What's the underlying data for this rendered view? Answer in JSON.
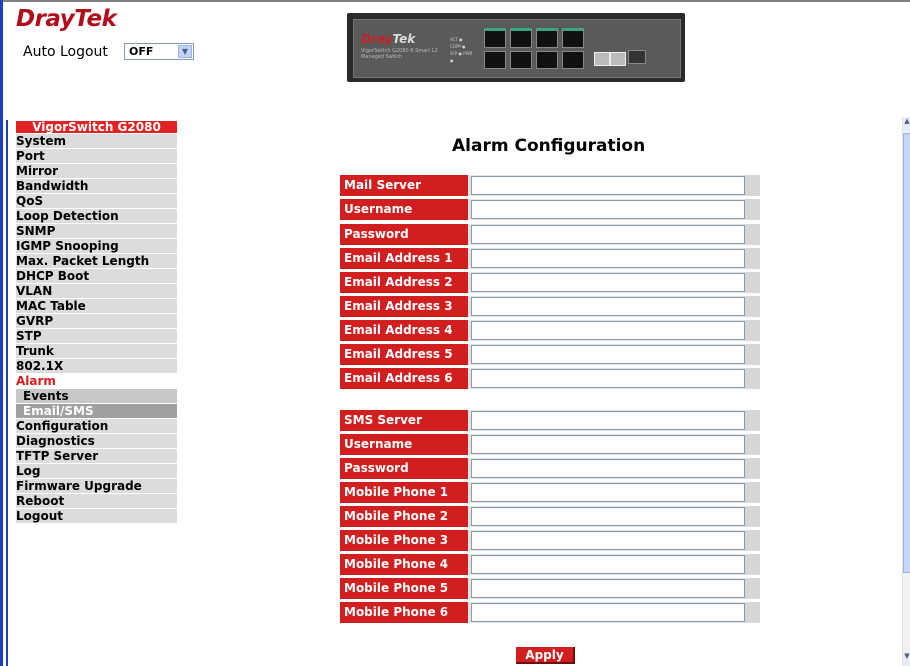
{
  "header": {
    "logo_primary": "Dray",
    "logo_secondary": "Tek",
    "auto_logout_label": "Auto Logout",
    "auto_logout_value": "OFF"
  },
  "device": {
    "brand_primary": "Dray",
    "brand_secondary": "Tek",
    "model_text": "VigorSwitch G2080 8 Smart L2 Managed Switch",
    "leds_text": "ACT ● COPP ● SFP ● PWR ●",
    "reset_label": "RESET"
  },
  "sidebar": {
    "title": "VigorSwitch G2080",
    "items": [
      "System",
      "Port",
      "Mirror",
      "Bandwidth",
      "QoS",
      "Loop Detection",
      "SNMP",
      "IGMP Snooping",
      "Max. Packet Length",
      "DHCP Boot",
      "VLAN",
      "MAC Table",
      "GVRP",
      "STP",
      "Trunk",
      "802.1X",
      "Alarm"
    ],
    "alarm_subitems": [
      "Events",
      "Email/SMS"
    ],
    "items_after": [
      "Configuration",
      "Diagnostics",
      "TFTP Server",
      "Log",
      "Firmware Upgrade",
      "Reboot",
      "Logout"
    ]
  },
  "main": {
    "title": "Alarm Configuration",
    "email_section": [
      {
        "label": "Mail Server",
        "value": ""
      },
      {
        "label": "Username",
        "value": ""
      },
      {
        "label": "Password",
        "value": ""
      },
      {
        "label": "Email Address 1",
        "value": ""
      },
      {
        "label": "Email Address 2",
        "value": ""
      },
      {
        "label": "Email Address 3",
        "value": ""
      },
      {
        "label": "Email Address 4",
        "value": ""
      },
      {
        "label": "Email Address 5",
        "value": ""
      },
      {
        "label": "Email Address 6",
        "value": ""
      }
    ],
    "sms_section": [
      {
        "label": "SMS Server",
        "value": ""
      },
      {
        "label": "Username",
        "value": ""
      },
      {
        "label": "Password",
        "value": ""
      },
      {
        "label": "Mobile Phone 1",
        "value": ""
      },
      {
        "label": "Mobile Phone 2",
        "value": ""
      },
      {
        "label": "Mobile Phone 3",
        "value": ""
      },
      {
        "label": "Mobile Phone 4",
        "value": ""
      },
      {
        "label": "Mobile Phone 5",
        "value": ""
      },
      {
        "label": "Mobile Phone 6",
        "value": ""
      }
    ],
    "apply_label": "Apply"
  },
  "icons": {
    "dropdown": "chevron-down-icon",
    "scroll_up": "scroll-up-icon",
    "scroll_down": "scroll-down-icon"
  },
  "colors": {
    "brand_red": "#d11e1e",
    "frame_blue": "#1f3fbf",
    "menu_gray": "#dcdcdc"
  }
}
